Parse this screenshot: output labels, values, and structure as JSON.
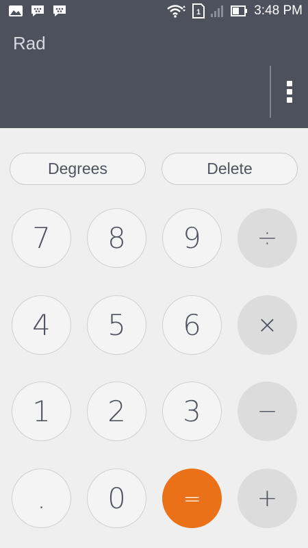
{
  "status_bar": {
    "time": "3:48 PM",
    "sim_slot": "1",
    "icons": [
      "image-icon",
      "bbm-icon",
      "bbm-icon",
      "wifi-icon",
      "sim-icon",
      "signal-icon",
      "battery-icon"
    ]
  },
  "display": {
    "mode": "Rad",
    "menu_icon": "more-vert-icon"
  },
  "controls": {
    "angle_button": "Degrees",
    "delete_button": "Delete"
  },
  "keypad": {
    "k7": "7",
    "k8": "8",
    "k9": "9",
    "divide": "÷",
    "k4": "4",
    "k5": "5",
    "k6": "6",
    "multiply": "×",
    "k1": "1",
    "k2": "2",
    "k3": "3",
    "subtract": "−",
    "dot": ".",
    "k0": "0",
    "equals": "=",
    "add": "+"
  },
  "colors": {
    "header_bg": "#4d515c",
    "body_bg": "#efefef",
    "equals_accent": "#ea7118",
    "operator_bg": "#dcdcdc",
    "text": "#4f535d"
  }
}
